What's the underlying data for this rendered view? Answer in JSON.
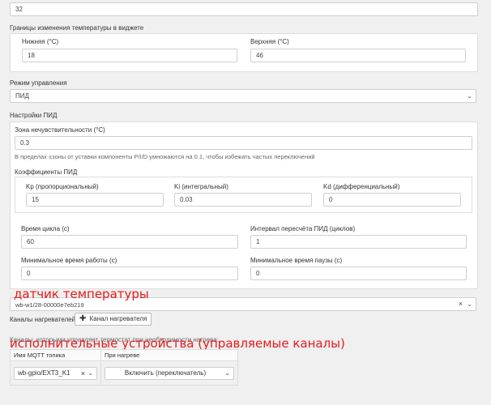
{
  "top_field": {
    "value": "32"
  },
  "bounds": {
    "title": "Границы изменения температуры в виджете",
    "lower": {
      "label": "Нижняя (°C)",
      "value": "18"
    },
    "upper": {
      "label": "Верхняя (°C)",
      "value": "46"
    }
  },
  "control_mode": {
    "label": "Режим управления",
    "value": "ПИД",
    "arrow": "⌄"
  },
  "pid": {
    "title": "Настройки ПИД",
    "deadband": {
      "label": "Зона нечувствительности (°C)",
      "value": "0.3",
      "help": "В пределах ±зоны от уставки компоненты P/I/D умножаются на 0.1, чтобы избежать частых переключений"
    },
    "coefficients": {
      "title": "Коэффициенты ПИД",
      "kp": {
        "label": "Kp (пропорциональный)",
        "value": "15"
      },
      "ki": {
        "label": "Ki (интегральный)",
        "value": "0.03"
      },
      "kd": {
        "label": "Kd (дифференциальный)",
        "value": "0"
      }
    },
    "cycle_time": {
      "label": "Время цикла (с)",
      "value": "60"
    },
    "recalc_interval": {
      "label": "Интервал пересчёта ПИД (циклов)",
      "value": "1"
    },
    "min_on_time": {
      "label": "Минимальное время работы (с)",
      "value": "0"
    },
    "min_off_time": {
      "label": "Минимальное время паузы (с)",
      "value": "0"
    }
  },
  "sensor": {
    "value": "wb-w1/28-00000e7eb219",
    "clear": "×",
    "arrow": "⌄"
  },
  "heaters": {
    "label": "Каналы нагревателей",
    "add_button": "Канал нагревателя",
    "plus": "✚",
    "description": "Каналы, которыми управляет термостат при необходимости нагрева:",
    "columns": [
      "Имя MQTT топика",
      "При нагреве"
    ],
    "rows": [
      {
        "topic": "wb-gpio/EXT3_K1",
        "clear": "×",
        "arrow": "⌄",
        "action": "Включить (переключатель)",
        "action_arrow": "⌄"
      }
    ]
  },
  "annotations": {
    "sensor": "датчик температуры",
    "actuators": "исполнительные устройства (управляемые каналы)",
    "color": "#e8191c"
  }
}
